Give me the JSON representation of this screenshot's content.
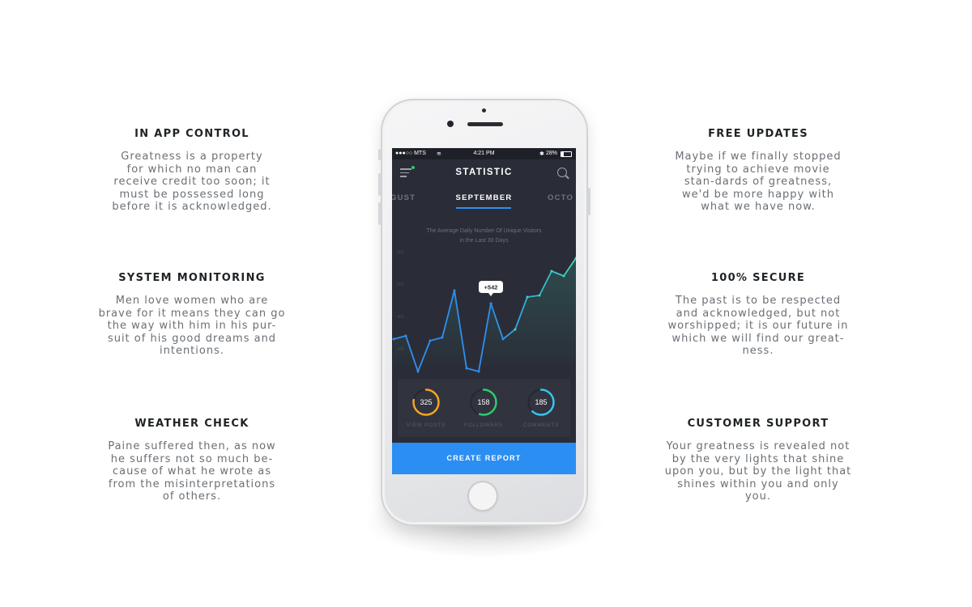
{
  "features": {
    "left": [
      {
        "title": "IN APP CONTROL",
        "text": "Greatness is a property for which no man can receive credit too soon; it must be possessed long before it is acknowledged."
      },
      {
        "title": "SYSTEM MONITORING",
        "text": "Men love women who are brave for it means they can go the way with him in his pur-suit of his good dreams and intentions."
      },
      {
        "title": "WEATHER CHECK",
        "text": "Paine suffered then, as now he suffers not so much be-cause of what he wrote as from the misinterpretations of others."
      }
    ],
    "right": [
      {
        "title": "FREE UPDATES",
        "text": "Maybe if we finally stopped trying to achieve movie stan-dards of greatness, we'd be more happy with what we have now."
      },
      {
        "title": "100% SECURE",
        "text": "The past is to be respected and acknowledged, but not worshipped; it is our future in which we will find our great-ness."
      },
      {
        "title": "CUSTOMER SUPPORT",
        "text": "Your greatness is revealed not by the very lights that shine upon you, but by the light that shines within you and only you."
      }
    ]
  },
  "phone": {
    "status": {
      "carrier": "●●●○○ MTS",
      "wifi": "≋",
      "time": "4:21 PM",
      "bluetooth": "✱",
      "battery": "28%"
    },
    "app_title": "STATISTIC",
    "months": {
      "prev": "GUST",
      "current": "SEPTEMBER",
      "next": "OCTO"
    },
    "chart_title_line1": "The Average Daily Number Of Unique Visitors",
    "chart_title_line2": "in the Last 30 Days",
    "tooltip": "+542",
    "stats": [
      {
        "value": "325",
        "label": "VIEW POSTS",
        "color": "#f5a623",
        "progress": 0.78
      },
      {
        "value": "158",
        "label": "FOLLOWERS",
        "color": "#2ecc71",
        "progress": 0.55
      },
      {
        "value": "185",
        "label": "COMMENTS",
        "color": "#36c5f0",
        "progress": 0.62
      }
    ],
    "cta": "CREATE REPORT",
    "colors": {
      "screen_bg": "#2a2d37",
      "accent": "#2b8ef2",
      "line": "#2f8ff0",
      "line_end": "#3fd6b7"
    }
  },
  "chart_data": {
    "type": "line",
    "title": "The Average Daily Number Of Unique Visitors in the Last 30 Days",
    "xlabel": "",
    "ylabel": "",
    "y_ticks": [
      "800",
      "600",
      "400",
      "200"
    ],
    "ylim": [
      100,
      850
    ],
    "grid": false,
    "annotation": {
      "text": "+542",
      "point_index": 8
    },
    "series": [
      {
        "values": [
          260,
          280,
          60,
          250,
          270,
          560,
          80,
          60,
          480,
          260,
          320,
          520,
          530,
          680,
          650,
          760
        ]
      }
    ]
  }
}
